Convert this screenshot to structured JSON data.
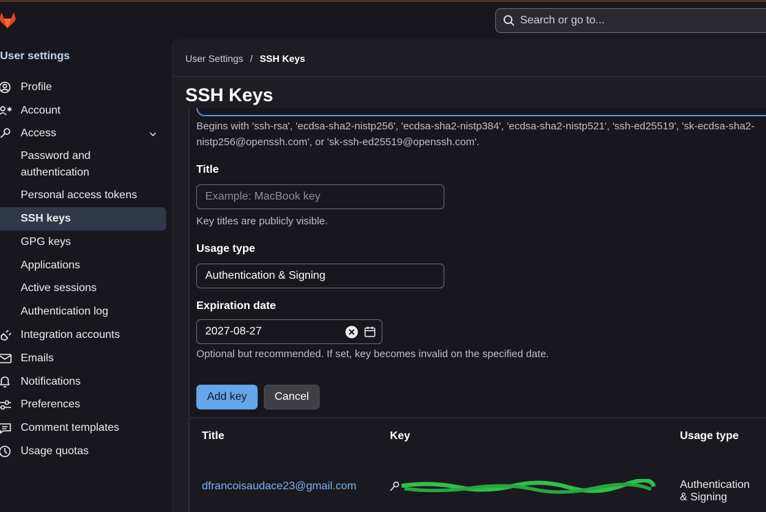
{
  "search": {
    "placeholder": "Search or go to..."
  },
  "sidebar": {
    "title": "User settings",
    "items": [
      {
        "label": "Profile",
        "icon": "profile-icon"
      },
      {
        "label": "Account",
        "icon": "account-icon"
      },
      {
        "label": "Access",
        "icon": "key-icon"
      },
      {
        "label": "Password and authentication"
      },
      {
        "label": "Personal access tokens"
      },
      {
        "label": "SSH keys"
      },
      {
        "label": "GPG keys"
      },
      {
        "label": "Applications"
      },
      {
        "label": "Active sessions"
      },
      {
        "label": "Authentication log"
      },
      {
        "label": "Integration accounts",
        "icon": "plug-icon"
      },
      {
        "label": "Emails",
        "icon": "mail-icon"
      },
      {
        "label": "Notifications",
        "icon": "bell-icon"
      },
      {
        "label": "Preferences",
        "icon": "preferences-icon"
      },
      {
        "label": "Comment templates",
        "icon": "comment-icon"
      },
      {
        "label": "Usage quotas",
        "icon": "quota-icon"
      }
    ]
  },
  "breadcrumb": {
    "parent": "User Settings",
    "separator": "/",
    "current": "SSH Keys"
  },
  "page": {
    "title": "SSH Keys"
  },
  "form": {
    "key_hint_line1": "Begins with 'ssh-rsa', 'ecdsa-sha2-nistp256', 'ecdsa-sha2-nistp384', 'ecdsa-sha2-nistp521', 'ssh-ed25519', 'sk-ecdsa-sha2-",
    "key_hint_line2": "nistp256@openssh.com', or 'sk-ssh-ed25519@openssh.com'.",
    "title_label": "Title",
    "title_placeholder": "Example: MacBook key",
    "title_hint": "Key titles are publicly visible.",
    "usage_label": "Usage type",
    "usage_value": "Authentication & Signing",
    "expiration_label": "Expiration date",
    "expiration_value": "2027-08-27",
    "expiration_hint": "Optional but recommended. If set, key becomes invalid on the specified date.",
    "add_button": "Add key",
    "cancel_button": "Cancel"
  },
  "table": {
    "headers": [
      "Title",
      "Key",
      "Usage type"
    ],
    "rows": [
      {
        "title": "dfrancoisaudace23@gmail.com",
        "key": "redacted",
        "usage_line1": "Authentication",
        "usage_line2": "& Signing"
      }
    ]
  },
  "colors": {
    "accent": "#63a6e9",
    "active_bg": "#31384a",
    "link": "#7cb3f0",
    "redaction": "#2ec04a"
  }
}
